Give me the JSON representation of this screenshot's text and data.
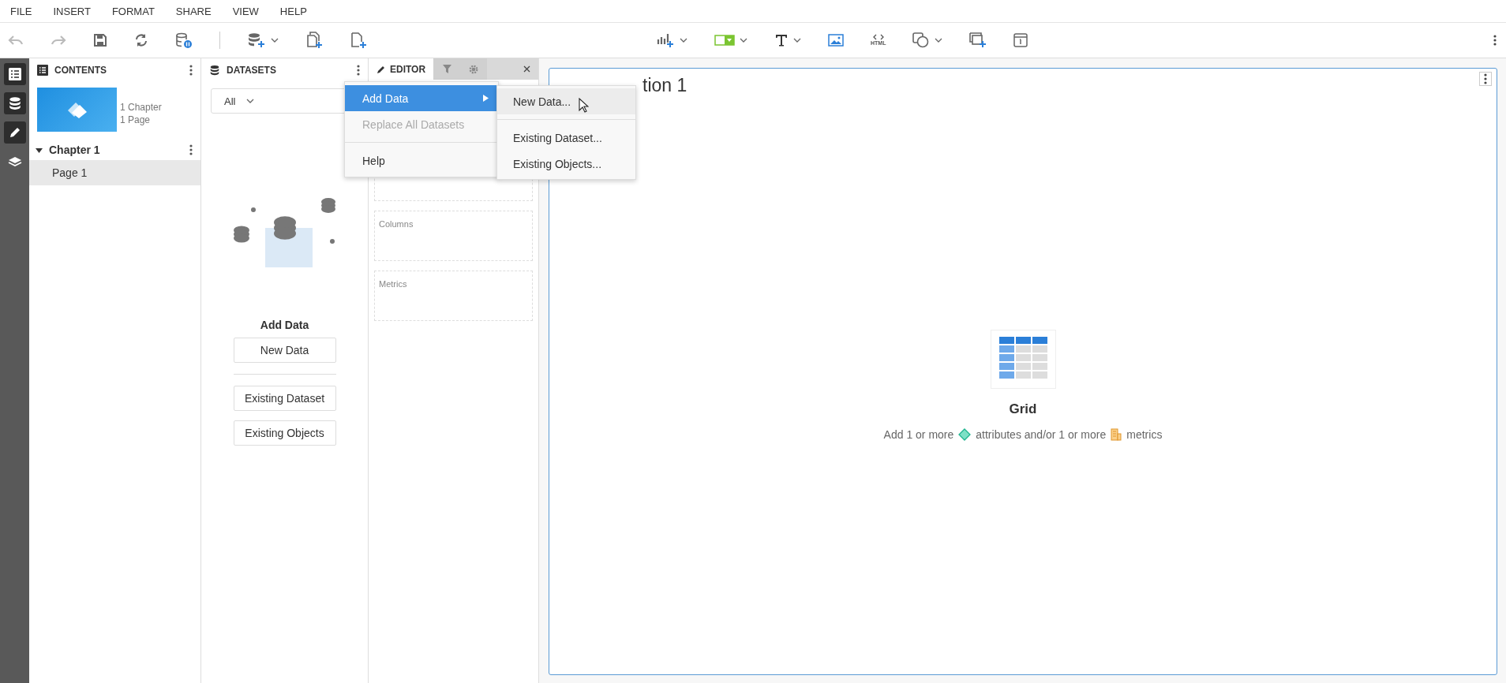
{
  "menu_bar": [
    {
      "label": "FILE"
    },
    {
      "label": "INSERT"
    },
    {
      "label": "FORMAT"
    },
    {
      "label": "SHARE"
    },
    {
      "label": "VIEW"
    },
    {
      "label": "HELP"
    }
  ],
  "toolbar": {
    "html_label": "HTML"
  },
  "rail": [
    {
      "kind": "contents",
      "on": true
    },
    {
      "kind": "datasets",
      "on": true
    },
    {
      "kind": "editor",
      "on": true
    },
    {
      "kind": "layers",
      "on": false
    }
  ],
  "contents": {
    "title": "CONTENTS",
    "summary": [
      "1 Chapter",
      "1 Page"
    ],
    "chapters": [
      {
        "title": "Chapter 1",
        "expanded": true,
        "pages": [
          {
            "label": "Page 1",
            "selected": true
          }
        ]
      }
    ]
  },
  "datasets": {
    "title": "DATASETS",
    "filter": "All",
    "empty_title": "Add Data",
    "buttons": [
      {
        "label": "New Data"
      },
      {
        "label": "Existing Dataset"
      },
      {
        "label": "Existing Objects"
      }
    ]
  },
  "editor": {
    "tabs": [
      {
        "kind": "editor",
        "label": "EDITOR",
        "selected": true
      },
      {
        "kind": "filter",
        "selected": false
      },
      {
        "kind": "format",
        "selected": false
      }
    ],
    "zones": [
      {
        "kind": "zone"
      },
      {
        "kind": "zone",
        "label": "Columns"
      },
      {
        "kind": "zone",
        "label": "Metrics"
      }
    ]
  },
  "context_menu": {
    "items": [
      {
        "kind": "item",
        "label": "Add Data",
        "selected": true,
        "disabled": false,
        "submenu": true
      },
      {
        "kind": "item",
        "label": "Replace All Datasets",
        "selected": false,
        "disabled": true,
        "submenu": false
      },
      {
        "kind": "separator"
      },
      {
        "kind": "item",
        "label": "Help",
        "selected": false,
        "disabled": false,
        "submenu": false
      }
    ],
    "submenu": [
      {
        "kind": "item",
        "label": "New Data...",
        "selected": true
      },
      {
        "kind": "separator"
      },
      {
        "kind": "item",
        "label": "Existing Dataset...",
        "selected": false
      },
      {
        "kind": "item",
        "label": "Existing Objects...",
        "selected": false
      }
    ]
  },
  "canvas": {
    "title": "tion 1",
    "placeholder_title": "Grid",
    "hint": [
      {
        "kind": "text",
        "text": "Add 1 or more"
      },
      {
        "kind": "attribute_icon"
      },
      {
        "kind": "text",
        "text": "attributes and/or 1 or more"
      },
      {
        "kind": "metric_icon"
      },
      {
        "kind": "text",
        "text": "metrics"
      }
    ]
  }
}
